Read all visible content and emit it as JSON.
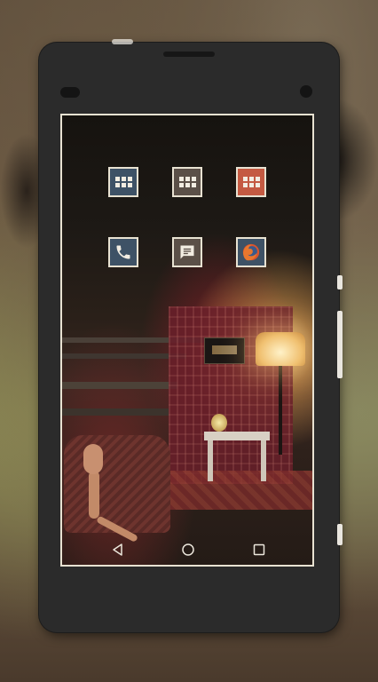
{
  "home_screen": {
    "app_icons": [
      {
        "name": "app-drawer-1",
        "icon": "grid-icon",
        "color": "#3e5266"
      },
      {
        "name": "app-drawer-2",
        "icon": "grid-icon",
        "color": "#5b5048"
      },
      {
        "name": "app-drawer-3",
        "icon": "grid-icon",
        "color": "#c45a42"
      },
      {
        "name": "phone",
        "icon": "phone-icon",
        "color": "#3e5266"
      },
      {
        "name": "messaging",
        "icon": "message-icon",
        "color": "#5b5048"
      },
      {
        "name": "browser",
        "icon": "firefox-icon",
        "color": "#3e5266"
      }
    ]
  },
  "navigation_bar": {
    "buttons": [
      "back-icon",
      "home-icon",
      "recents-icon"
    ]
  },
  "colors": {
    "icon_border": "#e8e2d2",
    "phone_body": "#2b2b2b",
    "accent_orange": "#c45a42",
    "accent_blue": "#3e5266"
  }
}
